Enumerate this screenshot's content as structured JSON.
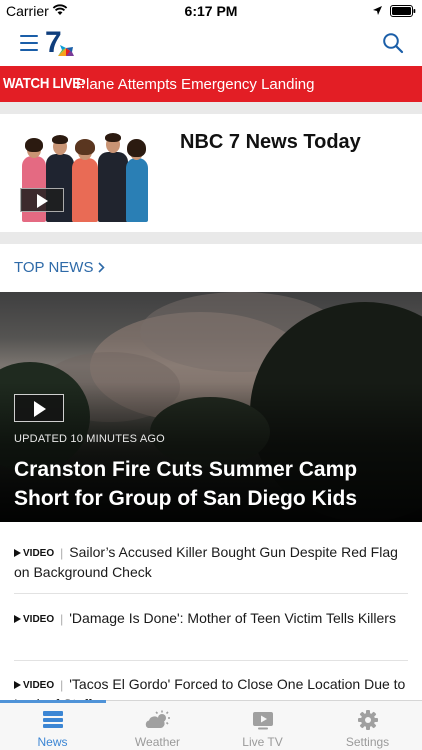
{
  "status_bar": {
    "carrier": "Carrier",
    "time": "6:17 PM"
  },
  "header": {
    "logo_text": "7"
  },
  "live_banner": {
    "tag": "WATCH LIVE:",
    "headline": "Plane Attempts Emergency Landing"
  },
  "show_card": {
    "title": "NBC 7 News Today"
  },
  "top_news": {
    "label": "TOP NEWS"
  },
  "hero": {
    "updated": "UPDATED 10 MINUTES AGO",
    "title": "Cranston Fire Cuts Summer Camp Short for Group of San Diego Kids"
  },
  "articles": [
    {
      "tag": "VIDEO",
      "title": "Sailor’s Accused Killer Bought Gun Despite Red Flag on Background Check"
    },
    {
      "tag": "VIDEO",
      "title": "'Damage Is Done': Mother of Teen Victim Tells Killers"
    },
    {
      "tag": "VIDEO",
      "title": "'Tacos El Gordo' Forced to Close One Location Due to Lack of Staff"
    }
  ],
  "tabs": [
    {
      "label": "News",
      "icon": "news-icon",
      "active": true
    },
    {
      "label": "Weather",
      "icon": "weather-icon",
      "active": false
    },
    {
      "label": "Live TV",
      "icon": "live-tv-icon",
      "active": false
    },
    {
      "label": "Settings",
      "icon": "gear-icon",
      "active": false
    }
  ],
  "colors": {
    "brand_red": "#e31e25",
    "link_blue": "#2e6aa8",
    "tab_active": "#3c86d4",
    "tab_inactive": "#9a9a9a"
  }
}
